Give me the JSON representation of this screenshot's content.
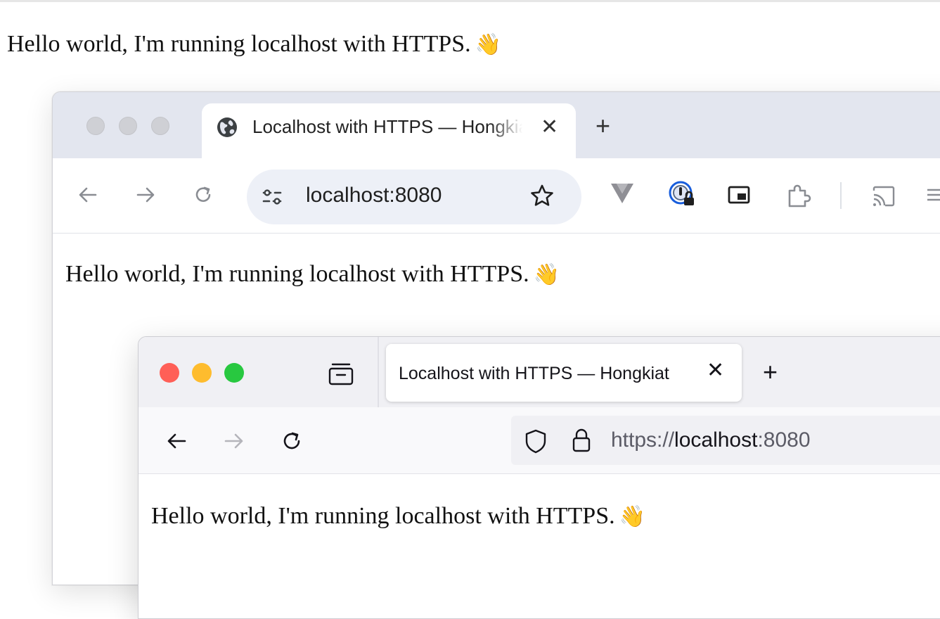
{
  "page": {
    "text": "Hello world, I'm running localhost with HTTPS.",
    "emoji": "👋"
  },
  "chrome": {
    "tab_title": "Localhost with HTTPS — Hongkiat",
    "tab_close": "✕",
    "new_tab": "+",
    "url": "localhost:8080",
    "content_text": "Hello world, I'm running localhost with HTTPS.",
    "content_emoji": "👋",
    "icons": [
      "back-icon",
      "forward-icon",
      "reload-icon",
      "site-info-icon",
      "bookmark-star-icon",
      "extension-v-icon",
      "password-lock-extension-icon",
      "picture-in-picture-icon",
      "extensions-puzzle-icon",
      "cast-icon",
      "menu-icon"
    ]
  },
  "firefox": {
    "traffic_colors": [
      "#ff5f57",
      "#febc2e",
      "#28c840"
    ],
    "tab_title": "Localhost with HTTPS — Hongkiat",
    "tab_close": "✕",
    "new_tab": "+",
    "url_scheme": "https://",
    "url_host": "localhost",
    "url_port": ":8080",
    "content_text": "Hello world, I'm running localhost with HTTPS.",
    "content_emoji": "👋",
    "icons": [
      "tab-list-icon",
      "back-icon",
      "forward-icon",
      "reload-icon",
      "tracking-shield-icon",
      "lock-icon"
    ]
  }
}
